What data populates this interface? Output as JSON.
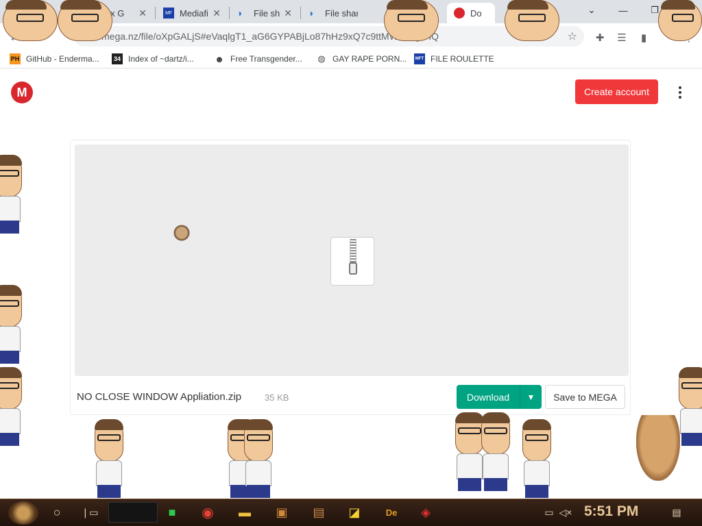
{
  "browser": {
    "tabs": [
      {
        "title": "Robux G",
        "icon": "roblox-icon",
        "active": false
      },
      {
        "title": "Mediafire",
        "icon": "mediafire-icon",
        "active": false
      },
      {
        "title": "File shar",
        "icon": "file-share-icon",
        "active": false
      },
      {
        "title": "File shar",
        "icon": "file-share-icon",
        "active": false
      },
      {
        "title": "Do",
        "icon": "mega-icon",
        "active": true
      }
    ],
    "url": "mega.nz/file/oXpGALjS#eVaqlgT1_aG6GYPABjLo87hHz9xQ7c9ttMWVV6yOIQ",
    "bookmarks": [
      {
        "label": "GitHub - Enderma...",
        "icon": "ph-icon",
        "icon_text": "PH"
      },
      {
        "label": "Index of ~dartz/i...",
        "icon": "qr-icon",
        "icon_text": "34"
      },
      {
        "label": "Free Transgender...",
        "icon": "user-icon",
        "icon_text": "☻"
      },
      {
        "label": "GAY RAPE PORN...",
        "icon": "globe-icon",
        "icon_text": "◍"
      },
      {
        "label": "FILE ROULETTE",
        "icon": "mft-icon",
        "icon_text": "MFT"
      }
    ]
  },
  "header": {
    "logo_text": "M",
    "create_account_label": "Create account"
  },
  "file": {
    "name": "NO CLOSE WINDOW Appliation.zip",
    "size": "35 KB",
    "download_label": "Download",
    "save_label": "Save to MEGA"
  },
  "taskbar": {
    "time": "5:51 PM"
  },
  "colors": {
    "mega_red": "#d9272e",
    "create_button": "#f0373a",
    "download_green": "#00a382"
  }
}
